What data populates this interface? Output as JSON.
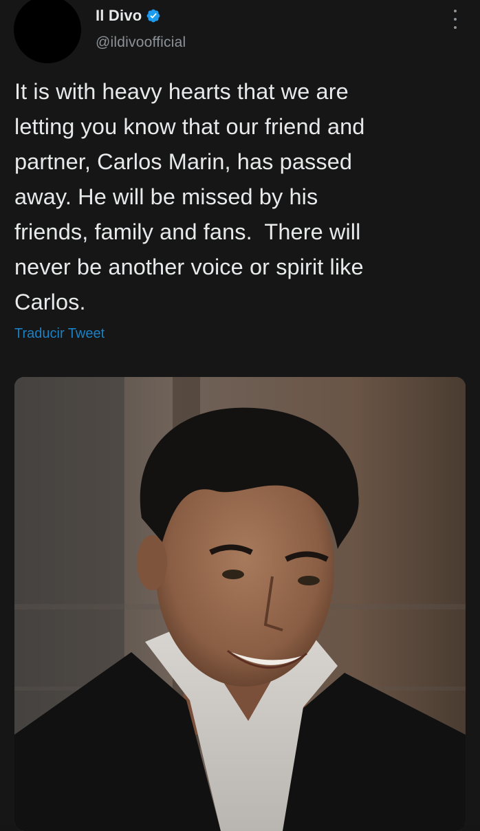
{
  "tweet": {
    "display_name": "Il Divo",
    "handle": "@ildivoofficial",
    "verified": true,
    "text": "It is with heavy hearts that we are\nletting you know that our friend and\npartner, Carlos Marin, has passed\naway. He will be missed by his\nfriends, family and fans.  There will\nnever be another voice or spirit like\nCarlos.",
    "translate_label": "Traducir Tweet",
    "media_icon": "portrait-photo",
    "more_icon": "more-vertical-icon",
    "verified_icon": "verified-badge-icon",
    "accent_color": "#1d9bf0"
  }
}
